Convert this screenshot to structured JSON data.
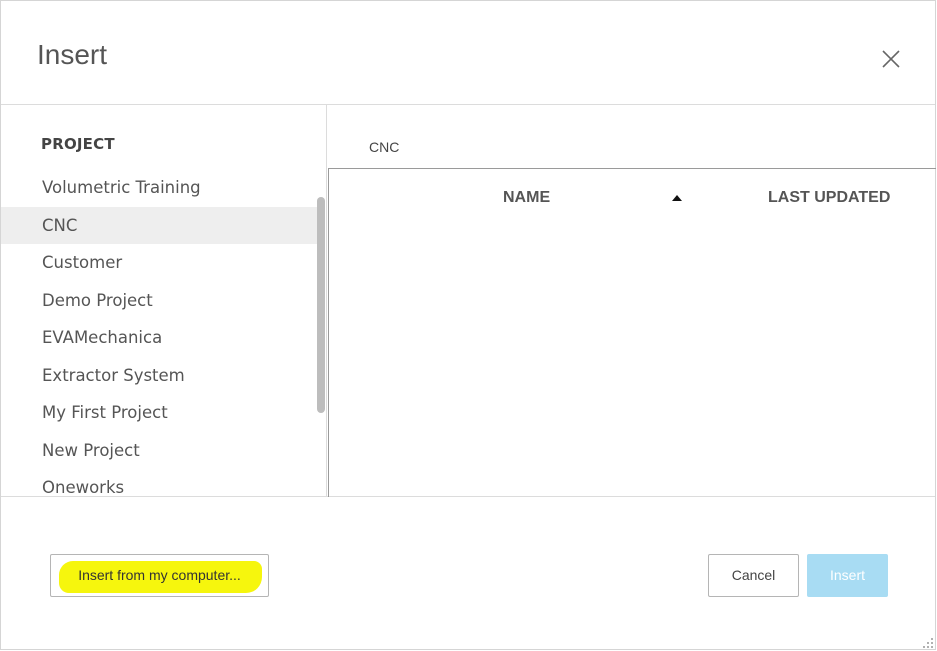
{
  "dialog": {
    "title": "Insert",
    "close_icon": "close-icon"
  },
  "sidebar": {
    "heading": "PROJECT",
    "selected_index": 1,
    "items": [
      {
        "label": "Volumetric Training"
      },
      {
        "label": "CNC"
      },
      {
        "label": "Customer"
      },
      {
        "label": "Demo Project"
      },
      {
        "label": "EVAMechanica"
      },
      {
        "label": "Extractor System"
      },
      {
        "label": "My First Project"
      },
      {
        "label": "New Project"
      },
      {
        "label": "Oneworks"
      }
    ]
  },
  "content": {
    "title": "CNC",
    "columns": [
      {
        "label": "NAME",
        "sort": "ascending"
      },
      {
        "label": "LAST UPDATED"
      }
    ],
    "rows": []
  },
  "footer": {
    "local_button_label": "Insert from my computer...",
    "cancel_label": "Cancel",
    "insert_label": "Insert"
  },
  "colors": {
    "highlight": "#f6f600",
    "insert_disabled": "#a8dcf3",
    "selected_row": "#eeeeee"
  }
}
